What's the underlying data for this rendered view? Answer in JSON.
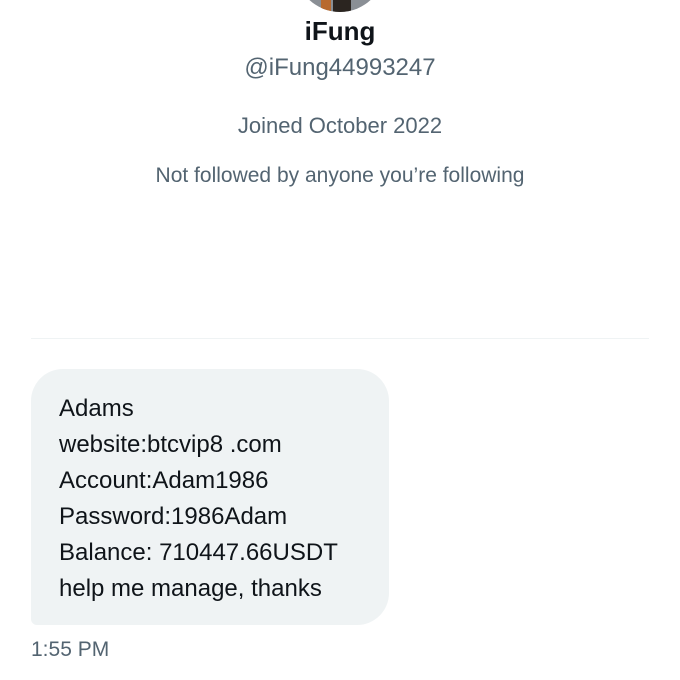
{
  "profile": {
    "name": "iFung",
    "handle": "@iFung44993247",
    "joined": "Joined October 2022",
    "followed_by": "Not followed by anyone you’re following"
  },
  "message": {
    "lines": [
      "Adams",
      "website:btcvip8 .com",
      "Account:Adam1986",
      "Password:1986Adam",
      "Balance: 710447.66USDT",
      "help me manage, thanks"
    ],
    "timestamp": "1:55 PM"
  },
  "colors": {
    "bubble_bg": "#eff3f4",
    "secondary_text": "#536471",
    "primary_text": "#0f1419"
  }
}
